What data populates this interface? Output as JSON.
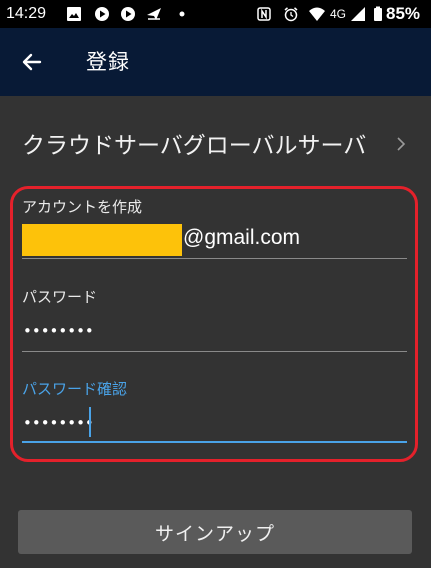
{
  "status_bar": {
    "time": "14:29",
    "network": "4G",
    "battery": "85%",
    "icons": [
      "image-icon",
      "play-icon",
      "play-icon",
      "paper-plane-icon",
      "dot-icon",
      "nfc-icon",
      "alarm-icon",
      "wifi-icon",
      "signal-icon",
      "battery-icon"
    ]
  },
  "app_bar": {
    "title": "登録",
    "back_icon": "arrow-left-icon"
  },
  "server": {
    "name": "クラウドサーバグローバルサーバ",
    "chevron_icon": "chevron-right-icon"
  },
  "form": {
    "create_account_label": "アカウントを作成",
    "email_suffix": "@gmail.com",
    "password_label": "パスワード",
    "password_value": "••••••••",
    "confirm_label": "パスワード確認",
    "confirm_value": "••••••••"
  },
  "signup_button": "サインアップ",
  "colors": {
    "app_bar": "#081a36",
    "background": "#333333",
    "accent": "#4aa3e8",
    "highlight_border": "#e4212b",
    "email_mask": "#fdc20a",
    "button": "#5a5a5a"
  }
}
